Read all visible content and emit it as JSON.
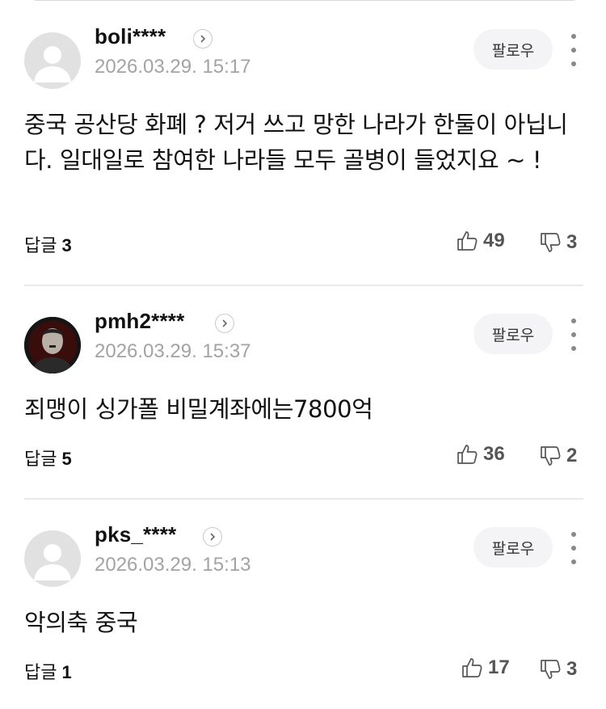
{
  "comments": [
    {
      "username": "boli****",
      "timestamp": "2026.03.29. 15:17",
      "follow_label": "팔로우",
      "body": "중국 공산당 화폐 ? 저거 쓰고 망한 나라가 한둘이 아닙니다. 일대일로 참여한 나라들 모두 골병이 들었지요 ~ !",
      "reply_label": "답글",
      "reply_count": "3",
      "likes": "49",
      "dislikes": "3",
      "avatar": "default-avatar-icon"
    },
    {
      "username": "pmh2****",
      "timestamp": "2026.03.29. 15:37",
      "follow_label": "팔로우",
      "body": "죄맹이 싱가폴 비밀계좌에는7800억",
      "reply_label": "답글",
      "reply_count": "5",
      "likes": "36",
      "dislikes": "2",
      "avatar": "profile-photo"
    },
    {
      "username": "pks_****",
      "timestamp": "2026.03.29. 15:13",
      "follow_label": "팔로우",
      "body": "악의축 중국",
      "reply_label": "답글",
      "reply_count": "1",
      "likes": "17",
      "dislikes": "3",
      "avatar": "default-avatar-icon"
    }
  ],
  "colors": {
    "text": "#111111",
    "muted": "#a3a3a3",
    "icon": "#555555",
    "follow_bg": "#f4f4f6",
    "divider": "#e9e9e9"
  }
}
